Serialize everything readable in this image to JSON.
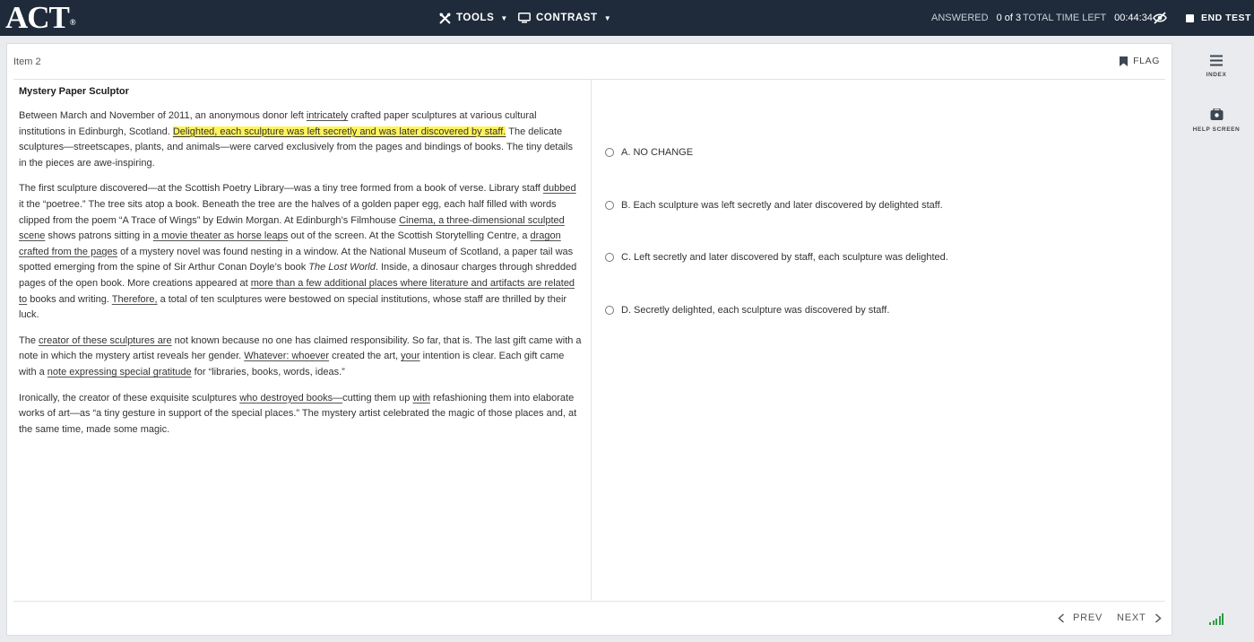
{
  "header": {
    "logo_text": "ACT",
    "logo_mark": "®",
    "tools_label": "TOOLS",
    "contrast_label": "CONTRAST",
    "answered_label": "ANSWERED",
    "answered_value": "0 of 3",
    "time_label": "TOTAL TIME LEFT",
    "time_value": "00:44:34",
    "end_test_label": "END TEST",
    "bg_color": "#1f2b3a"
  },
  "item": {
    "label": "Item 2",
    "flag_label": "FLAG"
  },
  "passage": {
    "title": "Mystery Paper Sculptor",
    "p1": {
      "a": "Between March and November of 2011, an anonymous donor left ",
      "u1": "intricately",
      "b": " crafted paper sculptures at various cultural institutions in Edinburgh, Scotland. ",
      "highlight": "Delighted, each sculpture was left secretly and was later discovered by staff.",
      "c": " The delicate sculptures—streetscapes, plants, and animals—were carved exclusively from the pages and bindings of books. The tiny details in the pieces are awe-inspiring."
    },
    "p2": {
      "a": "The first sculpture discovered—at the Scottish Poetry Library—was a tiny tree formed from a book of verse. Library staff ",
      "u1": "dubbed",
      "b": " it the “poetree.” The tree sits atop a book. Beneath the tree are the halves of a golden paper egg, each half filled with words clipped from the poem “A Trace of Wings” by Edwin Morgan. At Edinburgh’s Filmhouse ",
      "u2": "Cinema, a three-dimensional sculpted scene",
      "c": " shows patrons sitting in ",
      "u3": "a movie theater as horse leaps",
      "d": " out of the screen. At the Scottish Storytelling Centre, a ",
      "u4": "dragon crafted from the pages",
      "e": " of a mystery novel was found nesting in a window. At the National Museum of Scotland, a paper tail was spotted emerging from the spine of Sir Arthur Conan Doyle’s book ",
      "book_title": "The Lost World",
      "f": ". Inside, a dinosaur charges through shredded pages of the open book. More creations appeared at ",
      "u5": "more than a few additional places where literature and artifacts are related to",
      "g": " books and writing. ",
      "u6": "Therefore,",
      "h": " a total of ten sculptures were bestowed on special institutions, whose staff are thrilled by their luck."
    },
    "p3": {
      "a": "The ",
      "u1": "creator of these sculptures are",
      "b": " not known because no one has claimed responsibility. So far, that is. The last gift came with a note in which the mystery artist reveals her gender. ",
      "u2": "Whatever: whoever",
      "c": " created the art, ",
      "u3": "your",
      "d": " intention is clear. Each gift came with a ",
      "u4": "note expressing special gratitude",
      "e": " for “libraries, books, words, ideas.”"
    },
    "p4": {
      "a": "Ironically, the creator of these exquisite sculptures ",
      "u1": "who destroyed books—",
      "b": "cutting them up ",
      "u2": "with",
      "c": " refashioning them into elaborate works of art—as “a tiny gesture in support of the special places.” The mystery artist celebrated the magic of those places and, at the same time, made some magic."
    }
  },
  "options": [
    {
      "label": "A. NO CHANGE"
    },
    {
      "label": "B. Each sculpture was left secretly and later discovered by delighted staff."
    },
    {
      "label": "C. Left secretly and later discovered by staff, each sculpture was delighted."
    },
    {
      "label": "D. Secretly delighted, each sculpture was discovered by staff."
    }
  ],
  "footer": {
    "prev_label": "PREV",
    "next_label": "NEXT"
  },
  "rail": {
    "index_label": "INDEX",
    "help_label": "HELP SCREEN",
    "signal_color": "#2f9e44"
  },
  "icons": [
    "tools-icon",
    "monitor-icon",
    "hide-eye-icon",
    "end-test-icon",
    "flag-icon",
    "menu-icon",
    "help-icon",
    "chevron-left-icon",
    "chevron-right-icon",
    "signal-icon"
  ]
}
